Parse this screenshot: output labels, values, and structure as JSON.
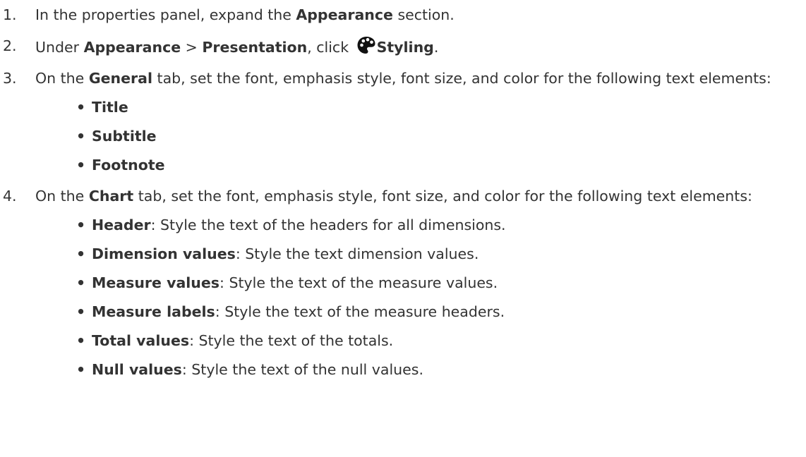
{
  "steps": [
    {
      "num": "1.",
      "before": "In the properties panel, expand the ",
      "bold": "Appearance",
      "after": " section."
    },
    {
      "num": "2.",
      "before": "Under ",
      "bold1": "Appearance",
      "sep": " > ",
      "bold2": "Presentation",
      "mid": ", click ",
      "icon": "palette-icon",
      "bold3": "Styling",
      "after": "."
    },
    {
      "num": "3.",
      "before": "On the ",
      "bold": "General",
      "after": " tab, set the font, emphasis style, font size, and color for the following text elements:",
      "items": [
        {
          "bold": "Title"
        },
        {
          "bold": "Subtitle"
        },
        {
          "bold": "Footnote"
        }
      ]
    },
    {
      "num": "4.",
      "before": "On the ",
      "bold": "Chart",
      "after": " tab, set the font, emphasis style, font size, and color for the following text elements:",
      "items": [
        {
          "bold": "Header",
          "text": ": Style the text of the headers for all dimensions."
        },
        {
          "bold": "Dimension values",
          "text": ": Style the text dimension values."
        },
        {
          "bold": "Measure values",
          "text": ": Style the text of the measure values."
        },
        {
          "bold": "Measure labels",
          "text": ": Style the text of the measure headers."
        },
        {
          "bold": "Total values",
          "text": ": Style the text of the totals."
        },
        {
          "bold": "Null values",
          "text": ": Style the text of the null values."
        }
      ]
    }
  ]
}
